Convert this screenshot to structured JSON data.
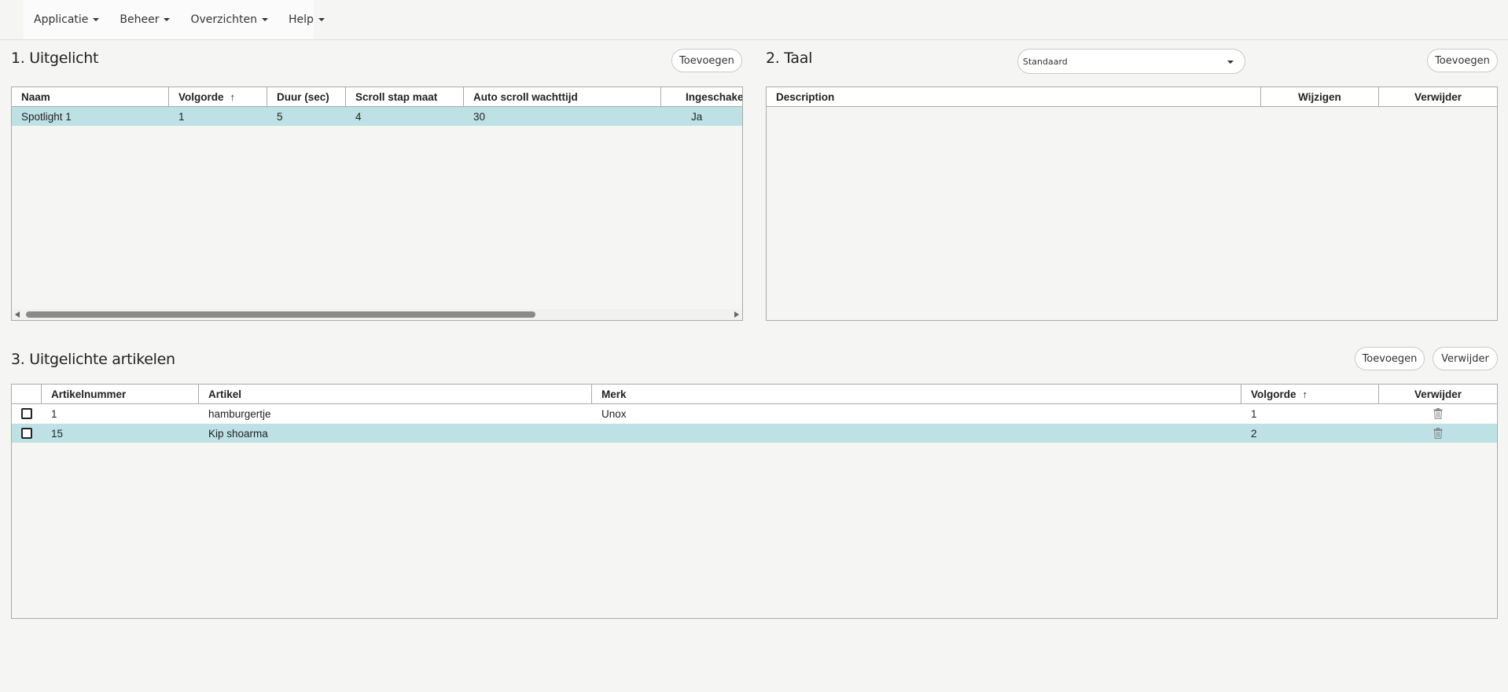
{
  "menu": {
    "items": [
      {
        "label": "Applicatie"
      },
      {
        "label": "Beheer"
      },
      {
        "label": "Overzichten"
      },
      {
        "label": "Help"
      }
    ]
  },
  "uitgelicht": {
    "title": "1. Uitgelicht",
    "add_label": "Toevoegen",
    "columns": [
      "Naam",
      "Volgorde",
      "Duur (sec)",
      "Scroll stap maat",
      "Auto scroll wachttijd",
      "Ingeschakeld"
    ],
    "sort_indicator": "↑",
    "rows": [
      {
        "naam": "Spotlight 1",
        "volgorde": "1",
        "duur": "5",
        "scroll": "4",
        "wacht": "30",
        "ingeschakeld": "Ja"
      }
    ]
  },
  "taal": {
    "title": "2. Taal",
    "select_value": "Standaard",
    "add_label": "Toevoegen",
    "columns": [
      "Description",
      "Wijzigen",
      "Verwijder"
    ]
  },
  "artikelen": {
    "title": "3. Uitgelichte artikelen",
    "add_label": "Toevoegen",
    "delete_label": "Verwijder",
    "columns": [
      "Artikelnummer",
      "Artikel",
      "Merk",
      "Volgorde",
      "Verwijder"
    ],
    "sort_indicator": "↑",
    "rows": [
      {
        "nummer": "1",
        "artikel": "hamburgertje",
        "merk": "Unox",
        "volgorde": "1"
      },
      {
        "nummer": "15",
        "artikel": "Kip shoarma",
        "merk": "",
        "volgorde": "2"
      }
    ]
  },
  "colors": {
    "selected_row": "#bde1e5",
    "background": "#f5f5f4",
    "border": "#aaaaaa"
  }
}
